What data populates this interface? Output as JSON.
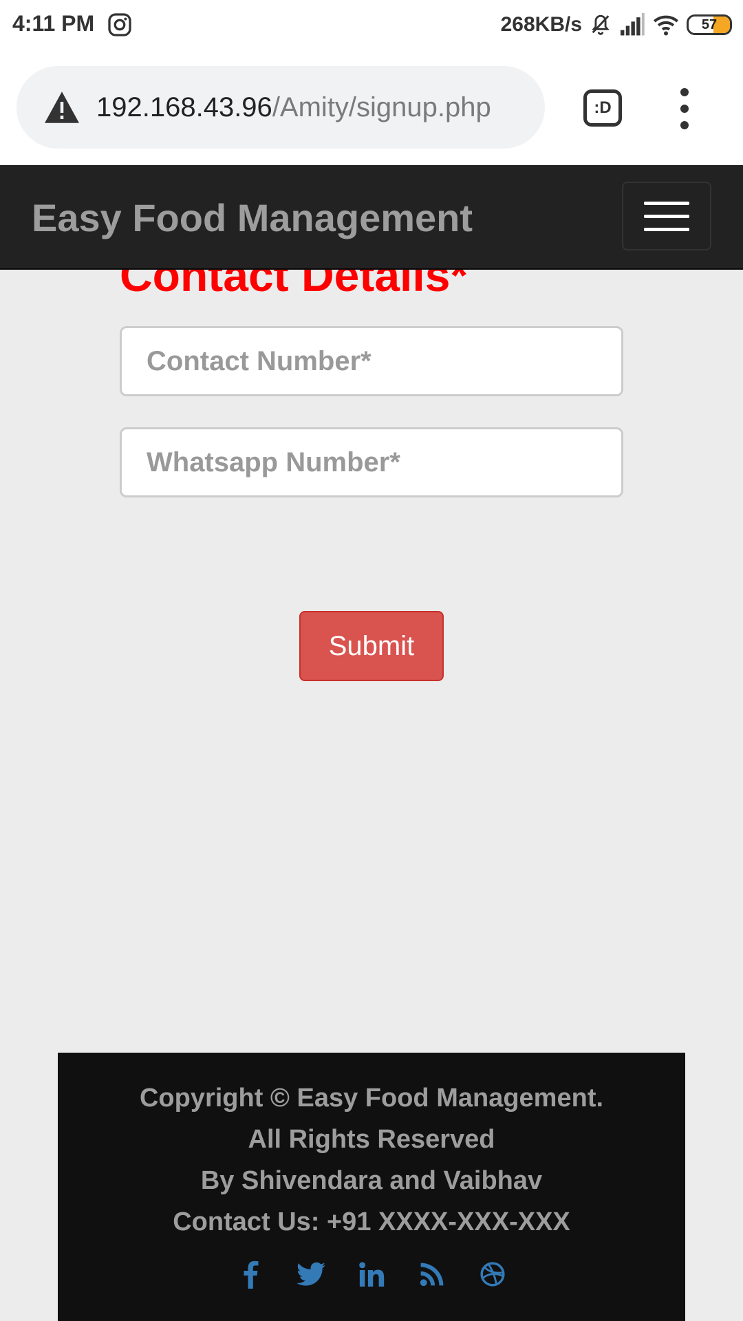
{
  "status_bar": {
    "time": "4:11 PM",
    "network_speed": "268KB/s",
    "battery_level": "57",
    "icons": [
      "instagram-icon",
      "mute-icon",
      "signal-icon",
      "wifi-icon",
      "battery-icon"
    ]
  },
  "browser": {
    "url_host": "192.168.43.96",
    "url_path": "/Amity/signup.php",
    "tab_switcher_label": ":D"
  },
  "navbar": {
    "brand": "Easy Food Management"
  },
  "form": {
    "section_title": "Contact Details*",
    "contact_placeholder": "Contact Number*",
    "whatsapp_placeholder": "Whatsapp Number*",
    "submit_label": "Submit"
  },
  "footer": {
    "copyright": "Copyright © Easy Food Management.",
    "rights": "All Rights Reserved",
    "authors": "By Shivendara and Vaibhav",
    "contact": "Contact Us: +91 XXXX-XXX-XXX",
    "social_icons": [
      "facebook-icon",
      "twitter-icon",
      "linkedin-icon",
      "rss-icon",
      "dribbble-icon"
    ]
  },
  "colors": {
    "navbar_bg": "#222222",
    "brand_text": "#9d9d9d",
    "title_red": "#ff0000",
    "submit_bg": "#d9534f",
    "footer_bg": "#101010",
    "social_blue": "#337ab7"
  }
}
